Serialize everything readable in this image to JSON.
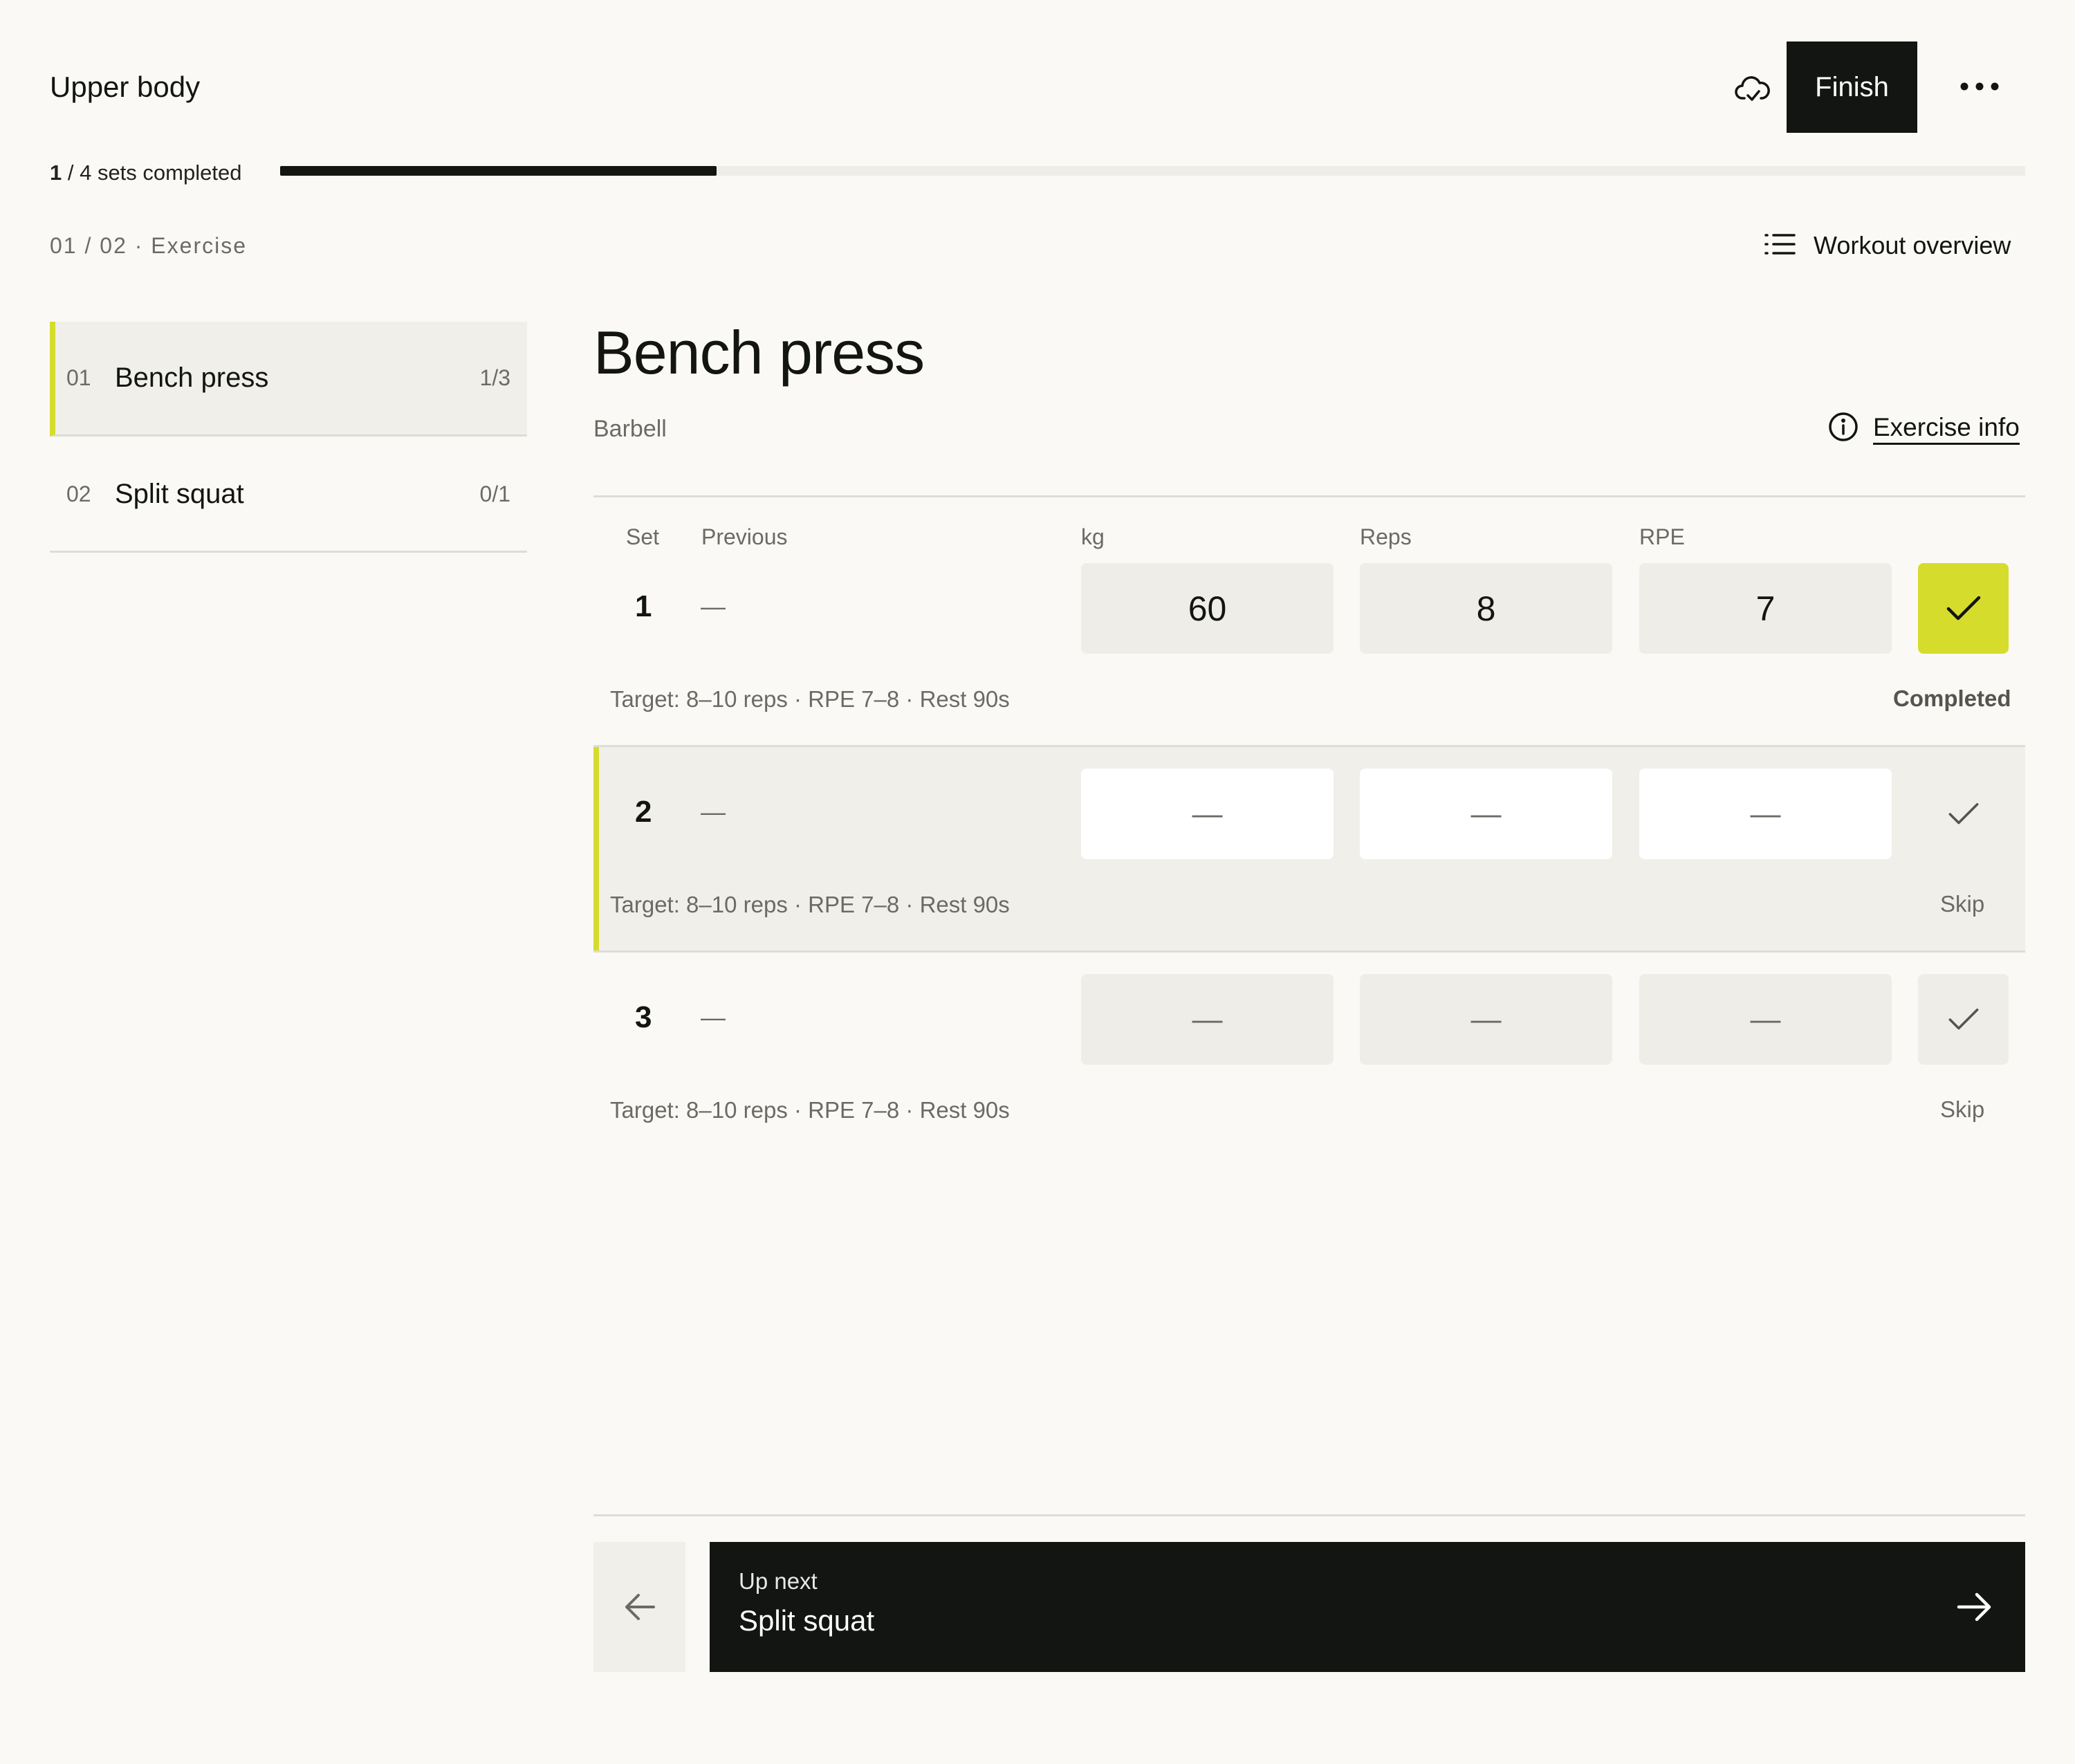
{
  "header": {
    "title": "Upper body",
    "finish_label": "Finish",
    "sync_icon": "cloud-sync-icon",
    "more_icon": "more-horizontal-icon"
  },
  "progress": {
    "completed": "1",
    "rest": " / 4 sets completed",
    "fraction": 0.25
  },
  "crumb": "01 / 02 · Exercise",
  "overview_label": "Workout overview",
  "sidebar": {
    "items": [
      {
        "num": "01",
        "name": "Bench press",
        "count": "1/3",
        "active": true
      },
      {
        "num": "02",
        "name": "Split squat",
        "count": "0/1",
        "active": false
      }
    ]
  },
  "exercise": {
    "title": "Bench press",
    "equipment": "Barbell",
    "info_label": "Exercise info"
  },
  "table": {
    "headers": {
      "set": "Set",
      "previous": "Previous",
      "kg": "kg",
      "reps": "Reps",
      "rpe": "RPE"
    }
  },
  "sets": [
    {
      "num": "1",
      "previous": "—",
      "kg": "60",
      "reps": "8",
      "rpe": "7",
      "target": "Target: 8–10 reps · RPE 7–8 · Rest 90s",
      "status": "Completed"
    },
    {
      "num": "2",
      "previous": "—",
      "kg": "",
      "reps": "",
      "rpe": "",
      "placeholder": "—",
      "target": "Target: 8–10 reps · RPE 7–8 · Rest 90s",
      "status": "Skip"
    },
    {
      "num": "3",
      "previous": "—",
      "kg": "",
      "reps": "",
      "rpe": "",
      "placeholder": "—",
      "target": "Target: 8–10 reps · RPE 7–8 · Rest 90s",
      "status": "Skip"
    }
  ],
  "footer": {
    "up_next_label": "Up next",
    "up_next_name": "Split squat"
  },
  "colors": {
    "accent": "#d6dc2c",
    "dark": "#121512",
    "background": "#faf9f6",
    "muted_cell": "#efede8"
  }
}
